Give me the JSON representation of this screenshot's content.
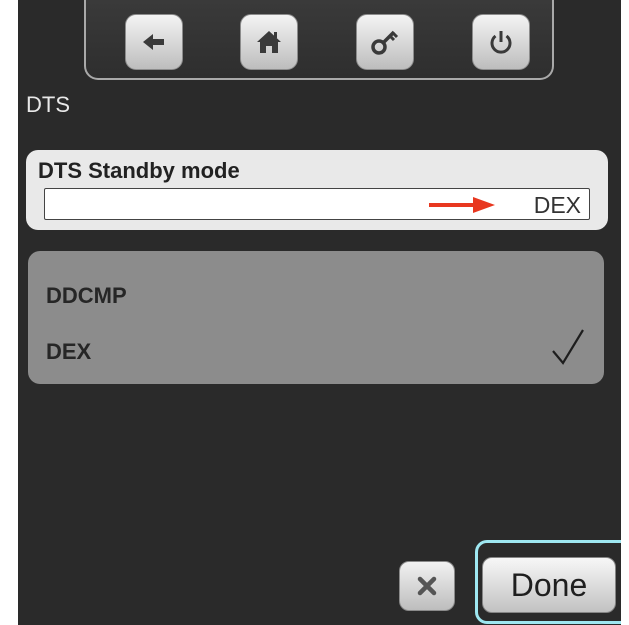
{
  "toolbar": {
    "buttons": [
      {
        "icon": "back-arrow-icon"
      },
      {
        "icon": "home-icon"
      },
      {
        "icon": "key-icon"
      },
      {
        "icon": "power-icon"
      }
    ]
  },
  "screen": {
    "title": "DTS"
  },
  "setting": {
    "label": "DTS Standby mode",
    "value": "DEX",
    "arrow_color": "#e8371f"
  },
  "options": [
    {
      "label": "DDCMP",
      "selected": false
    },
    {
      "label": "DEX",
      "selected": true
    }
  ],
  "footer": {
    "cancel_icon": "close-icon",
    "done_label": "Done",
    "highlight_color": "#9ee7f1"
  }
}
